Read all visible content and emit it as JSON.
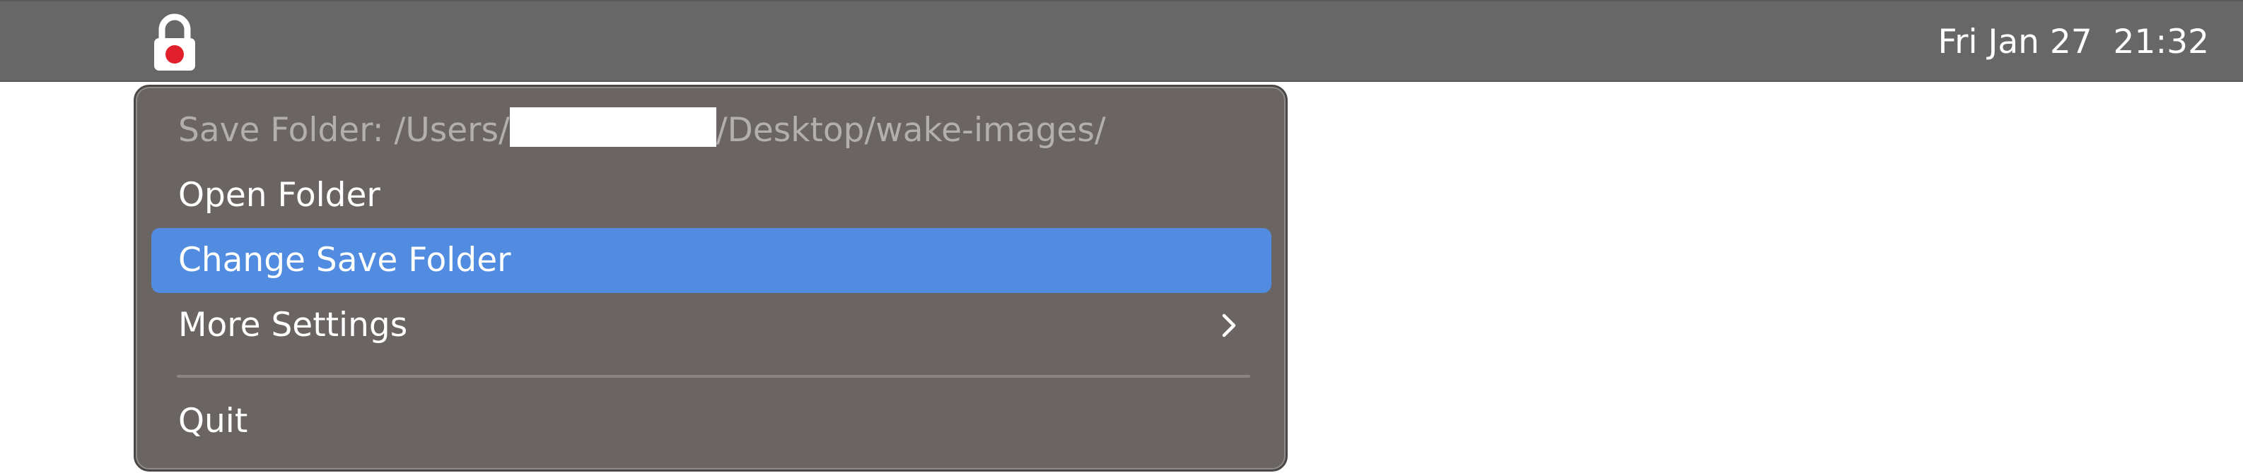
{
  "menubar": {
    "app_icon": "lock-icon",
    "clock": "Fri Jan 27  21:32"
  },
  "menu": {
    "save_folder_prefix": "Save Folder: /Users/",
    "save_folder_suffix": "/Desktop/wake-images/",
    "items": [
      {
        "label": "Open Folder"
      },
      {
        "label": "Change Save Folder"
      },
      {
        "label": "More Settings"
      },
      {
        "label": "Quit"
      }
    ],
    "submenu_icon": "chevron-right-icon"
  },
  "colors": {
    "menubar_bg": "#676767",
    "menu_bg": "#6a6563",
    "highlight": "#518ce0",
    "lock_red": "#e0202a"
  }
}
